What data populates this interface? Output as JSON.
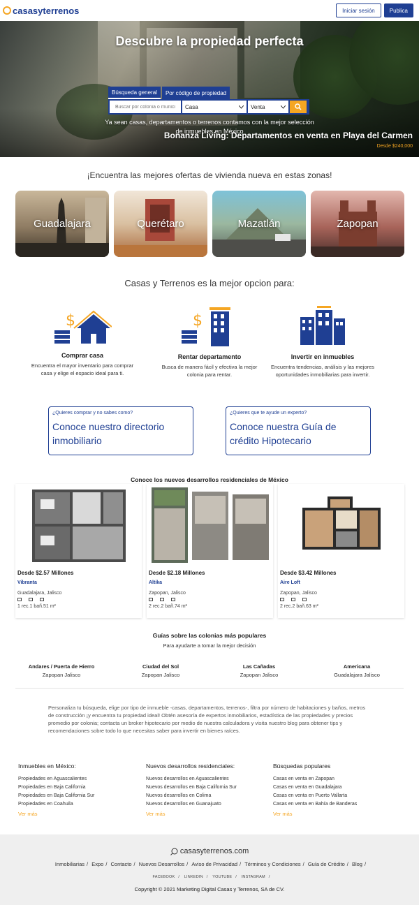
{
  "header": {
    "logo_text": "casasyterrenos",
    "login_label": "Iniciar sesión",
    "publish_label": "Publica"
  },
  "hero": {
    "title": "Descubre la propiedad perfecta",
    "tabs": [
      "Búsqueda general",
      "Por código de propiedad"
    ],
    "search_placeholder": "Buscar por colonia o municipio",
    "type_value": "Casa",
    "operation_value": "Venta",
    "subtitle": "Ya sean casas, departamentos o terrenos contamos con la mejor selección de inmuebles en México",
    "promo_title": "Bonanza Living: Departamentos en venta en Playa del Carmen",
    "promo_price": "Desde $240,000"
  },
  "zones": {
    "title": "¡Encuentra las mejores ofertas de vivienda nueva en estas zonas!",
    "items": [
      "Guadalajara",
      "Querétaro",
      "Mazatlán",
      "Zapopan"
    ]
  },
  "best": {
    "title": "Casas y Terrenos es la mejor opcion para:",
    "features": [
      {
        "title": "Comprar casa",
        "text": "Encuentra el mayor inventario para comprar casa y elige el espacio ideal para ti."
      },
      {
        "title": "Rentar departamento",
        "text": "Busca de manera fácil y efectiva la mejor colonia para rentar."
      },
      {
        "title": "Invertir en inmuebles",
        "text": "Encuentra tendencias, análisis y las mejores oportunidades inmobiliarias para invertir."
      }
    ],
    "ctas": [
      {
        "small": "¿Quieres comprar y no sabes como?",
        "big": "Conoce nuestro directorio inmobiliario"
      },
      {
        "small": "¿Quieres que te ayude un experto?",
        "big": "Conoce nuestra Guía de crédito Hipotecario"
      }
    ]
  },
  "developments": {
    "title": "Conoce los nuevos desarrollos residenciales de México",
    "items": [
      {
        "price": "Desde $2.57 Millones",
        "name": "Vibranta",
        "location": "Guadalajara, Jalisco",
        "specs": "1 rec.1 bañ.51 m²"
      },
      {
        "price": "Desde $2.18 Millones",
        "name": "Altika",
        "location": "Zapopan, Jalisco",
        "specs": "2 rec.2 bañ.74 m²"
      },
      {
        "price": "Desde $3.42 Millones",
        "name": "Aire Loft",
        "location": "Zapopan, Jalisco",
        "specs": "2 rec.2 bañ.63 m²"
      }
    ]
  },
  "guides": {
    "title": "Guías sobre las colonias más populares",
    "subtitle": "Para ayudarte a tomar la mejor decisión",
    "items": [
      {
        "name": "Andares / Puerta de Hierro",
        "city": "Zapopan Jalisco"
      },
      {
        "name": "Ciudad del Sol",
        "city": "Zapopan Jalisco"
      },
      {
        "name": "Las Cañadas",
        "city": "Zapopan Jalisco"
      },
      {
        "name": "Americana",
        "city": "Guadalajara Jalisco"
      }
    ]
  },
  "seo_text": "Personaliza tu búsqueda, elige por tipo de inmueble -casas, departamentos, terrenos-, filtra por número de habitaciones y baños, metros de construcción ¡y encuentra tu propiedad ideal! Obtén asesoría de expertos inmobiliarios, estadística de las propiedades y precios promedio por colonia; contacta un broker hipotecario por medio de nuestra calculadora y visita nuestro blog para obtener tips y recomendaciones sobre todo lo que necesitas saber para invertir en bienes raíces.",
  "columns": [
    {
      "title": "Inmuebles en México:",
      "links": [
        "Propiedades en Aguascalientes",
        "Propiedades en Baja California",
        "Propiedades en Baja California Sur",
        "Propiedades en Coahuila"
      ],
      "more": "Ver más"
    },
    {
      "title": "Nuevos desarrollos residenciales:",
      "links": [
        "Nuevos desarrollos en Aguascalientes",
        "Nuevos desarrollos en Baja California Sur",
        "Nuevos desarrollos en Colima",
        "Nuevos desarrollos en Guanajuato"
      ],
      "more": "Ver más"
    },
    {
      "title": "Búsquedas populares",
      "links": [
        "Casas en venta en Zapopan",
        "Casas en venta en Guadalajara",
        "Casas en venta en Puerto Vallarta",
        "Casas en venta en Bahía de Banderas"
      ],
      "more": "Ver más"
    }
  ],
  "footer": {
    "logo_text": "casasyterrenos.com",
    "links": [
      "Inmobiliarias",
      "Expo",
      "Contacto",
      "Nuevos Desarrollos",
      "Aviso de Privacidad",
      "Términos y Condiciones",
      "Guía de Crédito",
      "Blog"
    ],
    "social": [
      "FACEBOOK",
      "LINKEDIN",
      "YOUTUBE",
      "INSTAGRAM"
    ],
    "copyright": "Copyright © 2021 Marketing Digital Casas y Terrenos, SA de CV."
  },
  "colors": {
    "brand": "#1f3f93",
    "accent": "#f5a623"
  }
}
